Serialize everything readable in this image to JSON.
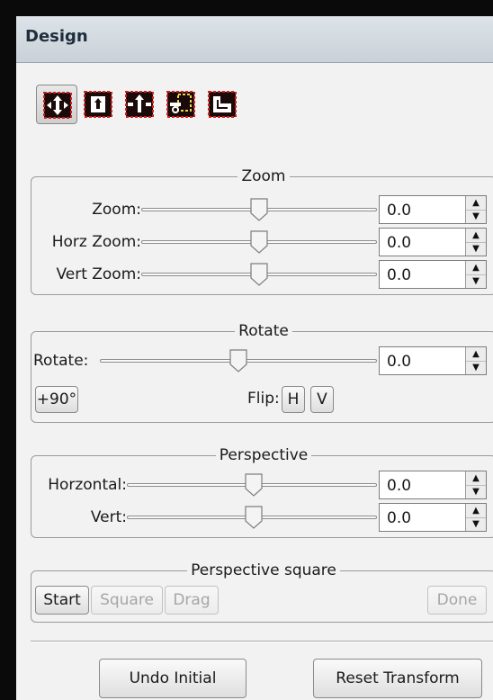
{
  "title": "Design",
  "toolbar": {
    "tools": [
      {
        "icon": "transform-move-icon",
        "active": true
      },
      {
        "icon": "transform-scale-icon",
        "active": false
      },
      {
        "icon": "transform-rotate-icon",
        "active": false
      },
      {
        "icon": "transform-perspective-icon",
        "active": false
      },
      {
        "icon": "transform-crop-icon",
        "active": false
      }
    ]
  },
  "zoom_group": {
    "title": "Zoom",
    "rows": [
      {
        "label": "Zoom:",
        "value": "0.0"
      },
      {
        "label": "Horz Zoom:",
        "value": "0.0"
      },
      {
        "label": "Vert Zoom:",
        "value": "0.0"
      }
    ]
  },
  "rotate_group": {
    "title": "Rotate",
    "row": {
      "label": "Rotate:",
      "value": "0.0"
    },
    "plus90_label": "+90°",
    "flip_label": "Flip:",
    "flip_h": "H",
    "flip_v": "V"
  },
  "perspective_group": {
    "title": "Perspective",
    "rows": [
      {
        "label": "Horzontal:",
        "value": "0.0"
      },
      {
        "label": "Vert:",
        "value": "0.0"
      }
    ]
  },
  "perspective_square": {
    "title": "Perspective square",
    "start": "Start",
    "square": "Square",
    "drag": "Drag",
    "done": "Done"
  },
  "footer": {
    "undo_initial": "Undo Initial",
    "reset_transform": "Reset Transform"
  }
}
